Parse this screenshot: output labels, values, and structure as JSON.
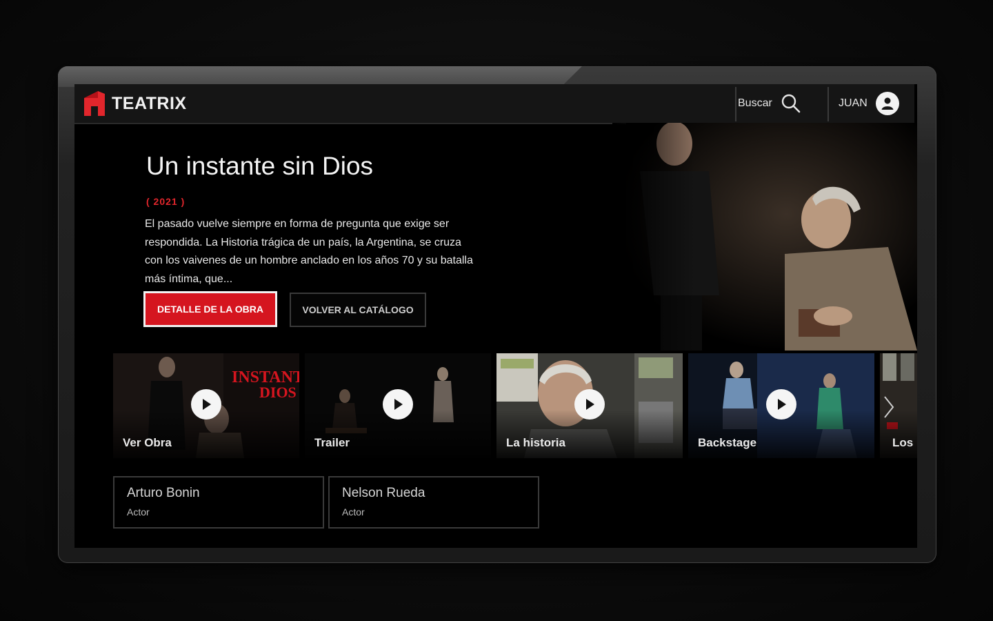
{
  "brand": {
    "name": "TEATRIX",
    "accent_color": "#d5151f"
  },
  "header": {
    "search_label": "Buscar",
    "search_icon": "search-icon",
    "user_label": "JUAN",
    "user_icon": "user-icon"
  },
  "hero": {
    "title": "Un instante sin Dios",
    "year": "( 2021 )",
    "synopsis": "El pasado vuelve siempre en forma de pregunta que exige ser respondida. La Historia trágica de un país, la Argentina, se cruza con los vaivenes de un hombre anclado en los años 70 y su batalla más íntima, que...",
    "primary_button": "DETALLE DE LA OBRA",
    "secondary_button": "VOLVER AL CATÁLOGO"
  },
  "media": {
    "items": [
      {
        "label": "Ver Obra",
        "poster_text_1": "INSTANTE",
        "poster_text_2": "DIOS"
      },
      {
        "label": "Trailer"
      },
      {
        "label": "La historia"
      },
      {
        "label": "Backstage"
      },
      {
        "label": "Los"
      }
    ],
    "next_icon": "chevron-right-icon"
  },
  "cast": [
    {
      "name": "Arturo Bonin",
      "role": "Actor"
    },
    {
      "name": "Nelson Rueda",
      "role": "Actor"
    }
  ]
}
